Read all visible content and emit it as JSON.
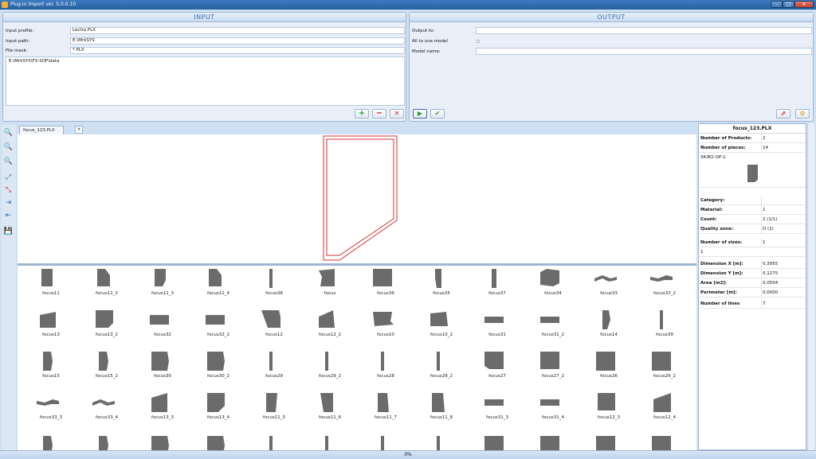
{
  "window": {
    "title": "Plug-in Import ver. 5.0.0.10",
    "min": "–",
    "max": "□",
    "close": "✕"
  },
  "input": {
    "header": "INPUT",
    "profile_label": "Input profile:",
    "profile_value": "Lectra PLX",
    "path_label": "Input path:",
    "path_value": "E:\\MrkSYS",
    "mask_label": "File mask:",
    "mask_value": "*.PLX",
    "list_item": "E:\\MrkSYS\\FX-SOF\\data",
    "add": "+",
    "remove": "−",
    "delete": "✕"
  },
  "output": {
    "header": "OUTPUT",
    "output_to_label": "Output to:",
    "output_to_value": "",
    "all_to_one_label": "All to one model",
    "model_name_label": "Model name:",
    "model_name_value": "",
    "run": "▶",
    "accept": "✔",
    "tool1": "⇗",
    "tool2": "⚙"
  },
  "tab": {
    "label": "focus_123.PLX",
    "close": "×"
  },
  "left_tools": [
    "🔍",
    "🔍",
    "🔍",
    "⤢",
    "⤡",
    "⇥",
    "⇤",
    "💾"
  ],
  "gallery": [
    [
      "focus11",
      "focus11_2",
      "focus11_3",
      "focus11_4",
      "focus38",
      "focus",
      "focus36",
      "focus35",
      "focus37",
      "focus34",
      "focus33",
      "focus33_2"
    ],
    [
      "focus13",
      "focus13_2",
      "focus32",
      "focus32_2",
      "focus12",
      "focus12_2",
      "focus10",
      "focus10_2",
      "focus31",
      "focus31_2",
      "focus14",
      "focus39"
    ],
    [
      "focus15",
      "focus15_2",
      "focus30",
      "focus30_2",
      "focus29",
      "focus29_2",
      "focus28",
      "focus28_2",
      "focus27",
      "focus27_2",
      "focus26",
      "focus26_2"
    ],
    [
      "focus33_3",
      "focus33_4",
      "focus13_3",
      "focus13_4",
      "focus11_5",
      "focus11_6",
      "focus11_7",
      "focus11_8",
      "focus31_3",
      "focus31_4",
      "focus12_3",
      "focus12_4"
    ]
  ],
  "info": {
    "title": "focus_123.PLX",
    "products_label": "Number of Products:",
    "products_value": "2",
    "pieces_label": "Number of pieces:",
    "pieces_value": "14",
    "piece_code": "SK-BO-OP-1",
    "category_label": "Category:",
    "category_value": "",
    "material_label": "Material:",
    "material_value": "1",
    "count_label": "Count:",
    "count_value": "2 (1/1)",
    "quality_label": "Quality zone:",
    "quality_value": "D (2)",
    "sizes_label": "Number of sizes:",
    "sizes_value": "1",
    "size_item": "1",
    "dimx_label": "Dimension X [m]:",
    "dimx_value": "0,3955",
    "dimy_label": "Dimension Y [m]:",
    "dimy_value": "0,1275",
    "area_label": "Area [m2]:",
    "area_value": "0,0504",
    "perimeter_label": "Perimeter [m]:",
    "perimeter_value": "0,0000",
    "lines_label": "Number of lines",
    "lines_value": "7"
  },
  "status": {
    "progress_text": "0%"
  },
  "colors": {
    "accent": "#3b6fb4",
    "piece_fill": "#6b6b6b",
    "outline": "#d32f2f",
    "add": "#2e9e2e",
    "remove": "#cc2222"
  }
}
